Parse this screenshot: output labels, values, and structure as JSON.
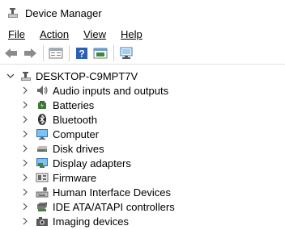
{
  "window": {
    "title": "Device Manager"
  },
  "menu": {
    "file": "File",
    "action": "Action",
    "view": "View",
    "help": "Help"
  },
  "toolbar": {
    "buttons": [
      "back-icon",
      "forward-icon",
      "properties-icon",
      "help-icon",
      "driver-icon",
      "scan-icon"
    ]
  },
  "tree": {
    "root": "DESKTOP-C9MPT7V",
    "items": [
      {
        "label": "Audio inputs and outputs",
        "icon": "speaker-icon"
      },
      {
        "label": "Batteries",
        "icon": "battery-icon"
      },
      {
        "label": "Bluetooth",
        "icon": "bluetooth-icon"
      },
      {
        "label": "Computer",
        "icon": "computer-icon"
      },
      {
        "label": "Disk drives",
        "icon": "disk-drive-icon"
      },
      {
        "label": "Display adapters",
        "icon": "display-adapter-icon"
      },
      {
        "label": "Firmware",
        "icon": "firmware-icon"
      },
      {
        "label": "Human Interface Devices",
        "icon": "hid-icon"
      },
      {
        "label": "IDE ATA/ATAPI controllers",
        "icon": "ide-controller-icon"
      },
      {
        "label": "Imaging devices",
        "icon": "camera-icon"
      }
    ]
  }
}
